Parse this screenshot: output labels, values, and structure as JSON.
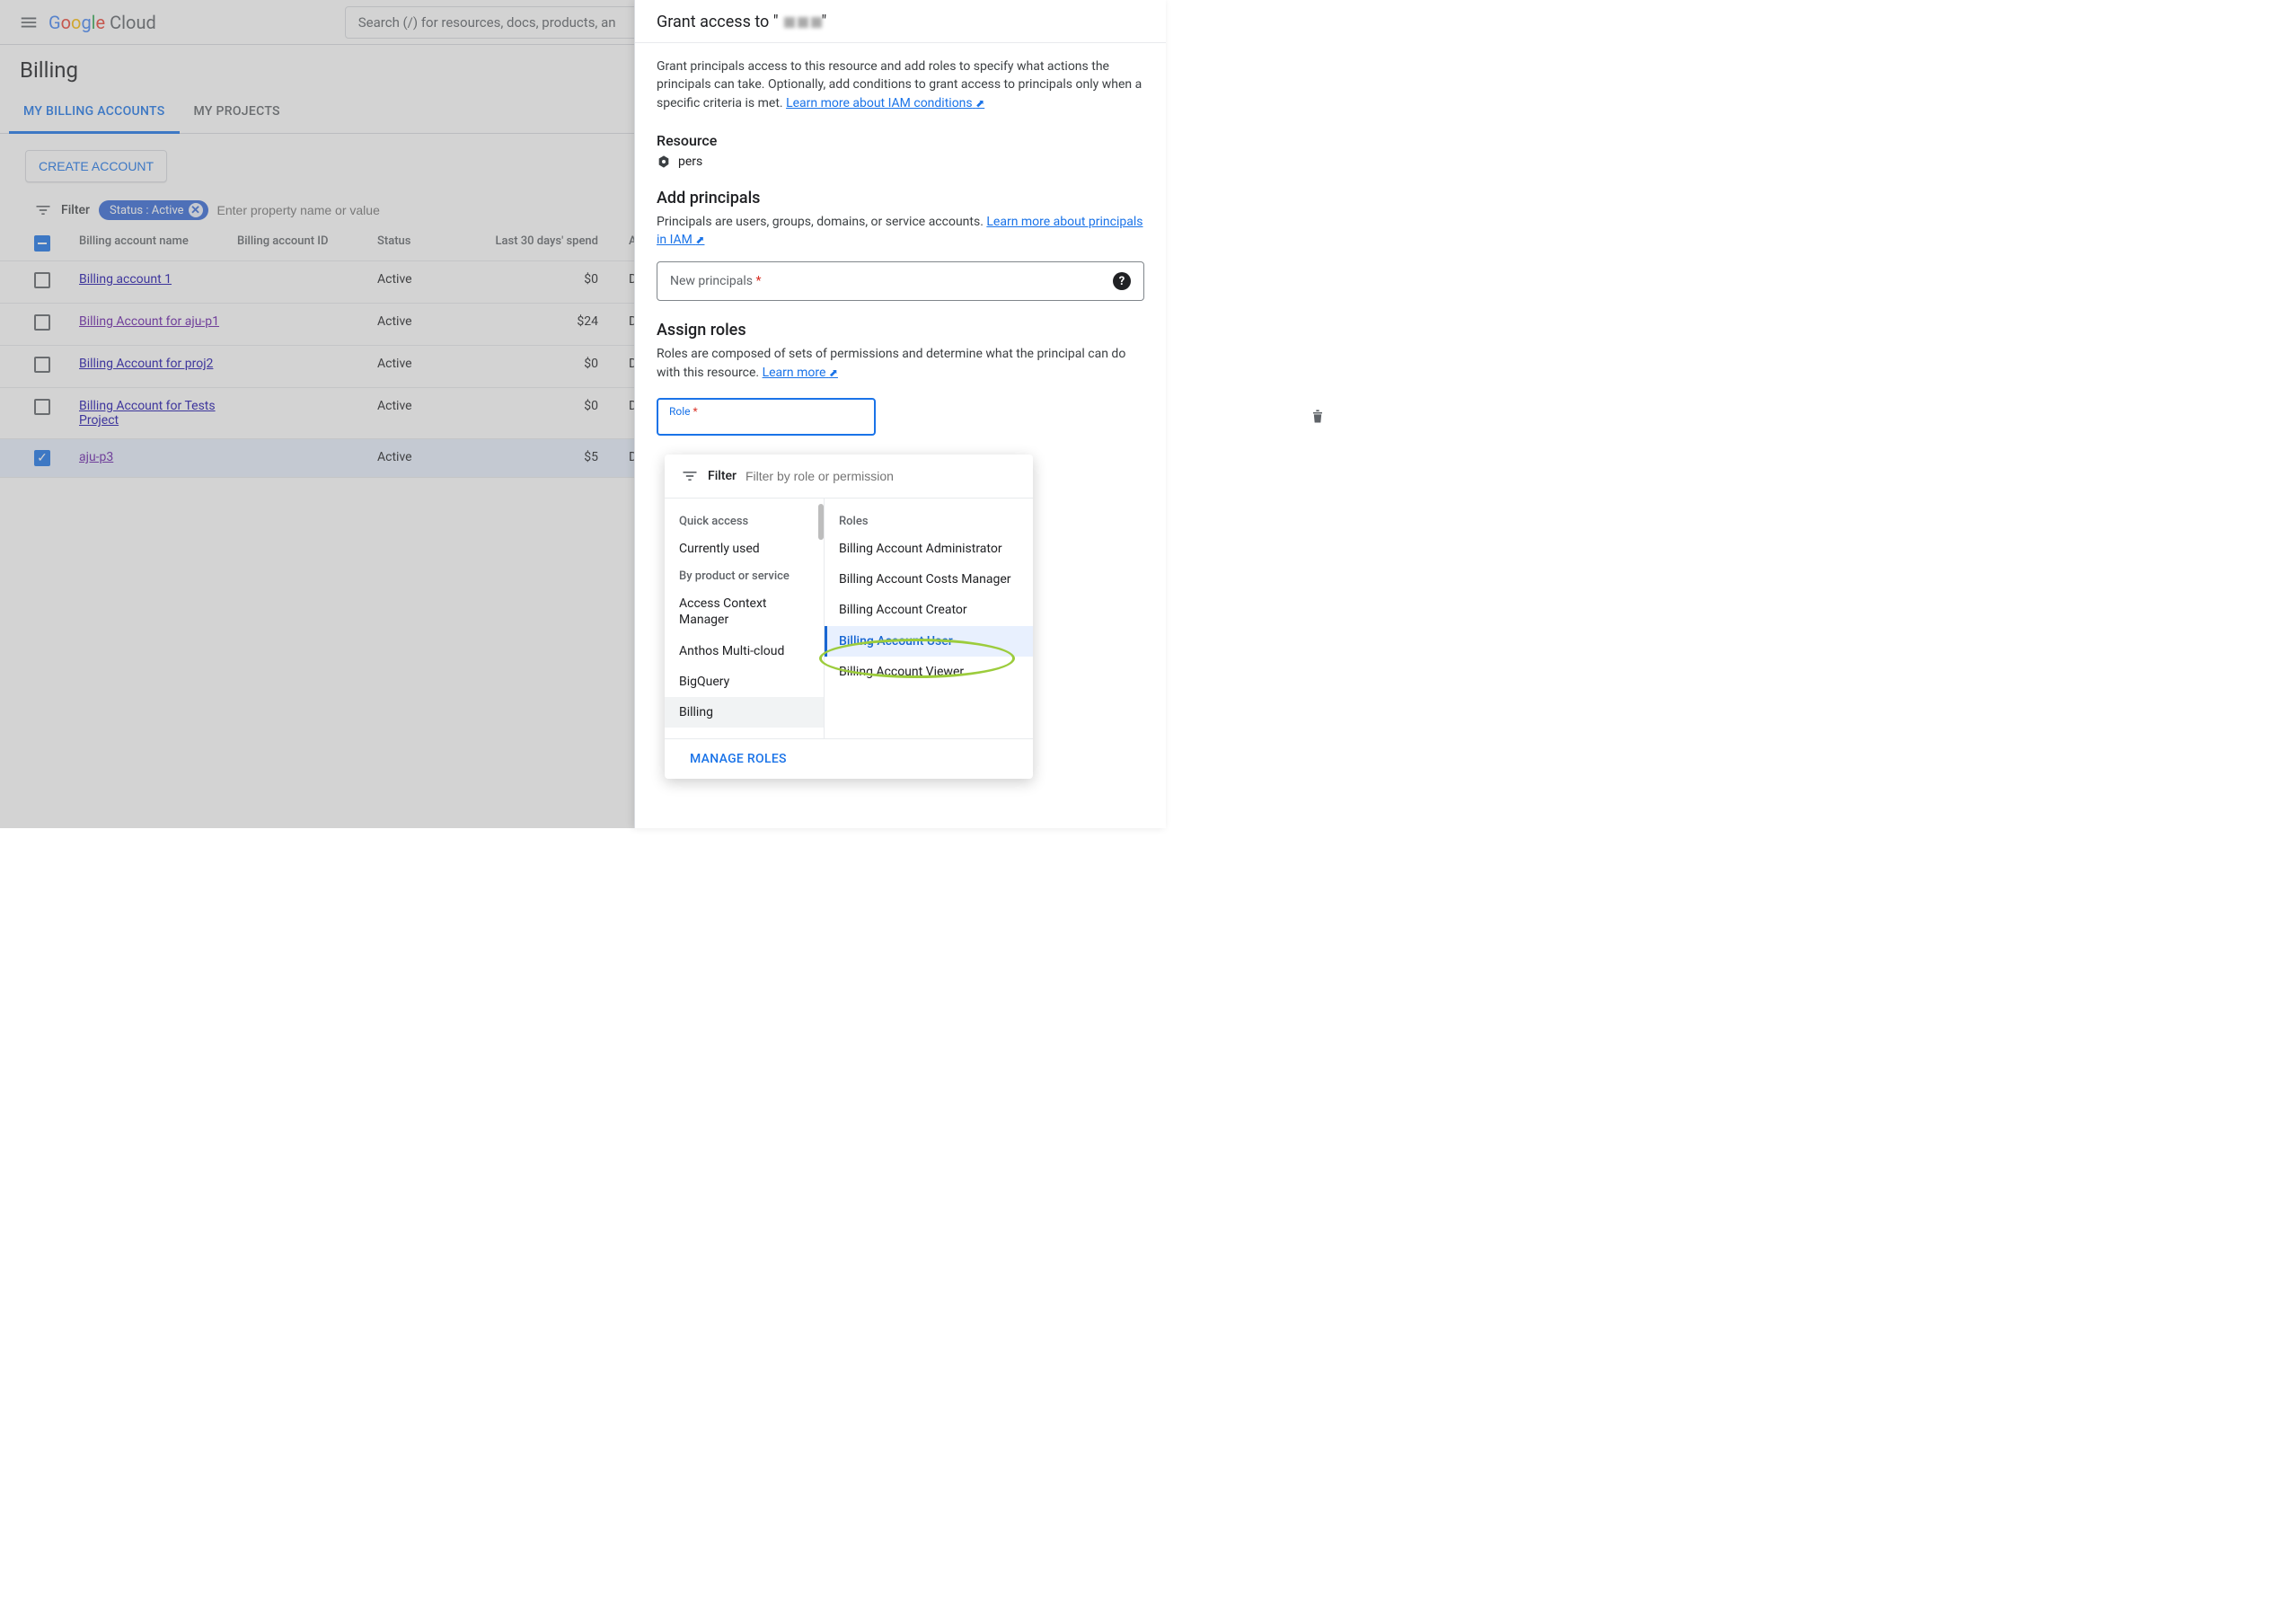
{
  "header": {
    "search_placeholder": "Search (/) for resources, docs, products, an",
    "logo_text": "Google Cloud"
  },
  "page": {
    "title": "Billing"
  },
  "tabs": [
    {
      "label": "MY BILLING ACCOUNTS",
      "active": true
    },
    {
      "label": "MY PROJECTS",
      "active": false
    }
  ],
  "toolbar": {
    "create_account_label": "CREATE ACCOUNT"
  },
  "filter": {
    "label": "Filter",
    "chip_text": "Status : Active",
    "input_placeholder": "Enter property name or value"
  },
  "table": {
    "columns": {
      "name": "Billing account name",
      "id": "Billing account ID",
      "status": "Status",
      "spend": "Last 30 days' spend",
      "actions": "Ac"
    },
    "rows": [
      {
        "name": "Billing account 1",
        "status": "Active",
        "spend": "$0",
        "actions": "Di",
        "selected": false,
        "visited": false
      },
      {
        "name": "Billing Account for aju-p1",
        "status": "Active",
        "spend": "$24",
        "actions": "Di",
        "selected": false,
        "visited": true
      },
      {
        "name": "Billing Account for proj2",
        "status": "Active",
        "spend": "$0",
        "actions": "Di",
        "selected": false,
        "visited": false
      },
      {
        "name": "Billing Account for Tests Project",
        "status": "Active",
        "spend": "$0",
        "actions": "Di",
        "selected": false,
        "visited": false
      },
      {
        "name": "aju-p3",
        "status": "Active",
        "spend": "$5",
        "actions": "Di",
        "selected": true,
        "visited": true
      }
    ]
  },
  "panel": {
    "title_prefix": "Grant access to \"",
    "intro": "Grant principals access to this resource and add roles to specify what actions the principals can take. Optionally, add conditions to grant access to principals only when a specific criteria is met. ",
    "iam_conditions_link": "Learn more about IAM conditions",
    "resource_h": "Resource",
    "resource_name": "pers",
    "add_principals_h": "Add principals",
    "principals_text": "Principals are users, groups, domains, or service accounts. ",
    "principals_link": "Learn more about principals in IAM",
    "new_principals_label": "New principals",
    "assign_roles_h": "Assign roles",
    "assign_roles_text": "Roles are composed of sets of permissions and determine what the principal can do with this resource. ",
    "learn_more": "Learn more",
    "role_label": "Role"
  },
  "dropdown": {
    "filter_label": "Filter",
    "filter_placeholder": "Filter by role or permission",
    "quick_access_h": "Quick access",
    "currently_used": "Currently used",
    "by_product_h": "By product or service",
    "left_items": [
      "Access Context Manager",
      "Anthos Multi-cloud",
      "BigQuery",
      "Billing"
    ],
    "roles_h": "Roles",
    "roles": [
      "Billing Account Administrator",
      "Billing Account Costs Manager",
      "Billing Account Creator",
      "Billing Account User",
      "Billing Account Viewer"
    ],
    "selected_role_index": 3,
    "selected_cat_index": 3,
    "manage_roles": "MANAGE ROLES"
  }
}
